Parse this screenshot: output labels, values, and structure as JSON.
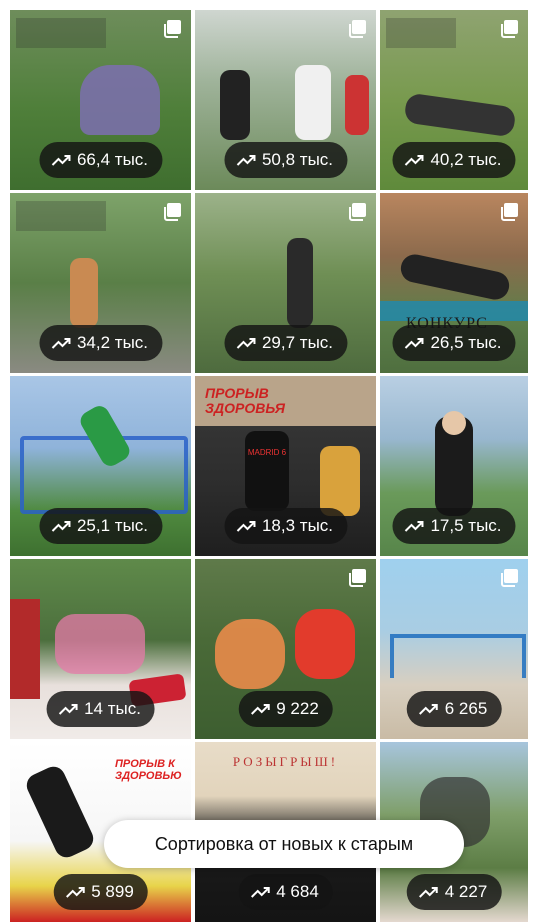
{
  "tiles": [
    {
      "views": "66,4 тыс.",
      "multi": true
    },
    {
      "views": "50,8 тыс.",
      "multi": true
    },
    {
      "views": "40,2 тыс.",
      "multi": true
    },
    {
      "views": "34,2 тыс.",
      "multi": true
    },
    {
      "views": "29,7 тыс.",
      "multi": true
    },
    {
      "views": "26,5 тыс.",
      "multi": true,
      "caption": "КОНКУРС"
    },
    {
      "views": "25,1 тыс.",
      "multi": false
    },
    {
      "views": "18,3 тыс.",
      "multi": false,
      "caption": "ПРОРЫВ ЗДОРОВЬЯ",
      "jersey": "MADRID 6"
    },
    {
      "views": "17,5 тыс.",
      "multi": false
    },
    {
      "views": "14 тыс.",
      "multi": false
    },
    {
      "views": "9 222",
      "multi": true
    },
    {
      "views": "6 265",
      "multi": true
    },
    {
      "views": "5 899",
      "multi": false,
      "caption": "ПРОРЫВ К ЗДОРОВЬЮ"
    },
    {
      "views": "4 684",
      "multi": false,
      "caption": "РОЗЫГРЫШ!"
    },
    {
      "views": "4 227",
      "multi": false
    }
  ],
  "toast": {
    "label": "Сортировка от новых к старым"
  },
  "colors": {
    "badge_bg": "#141414",
    "toast_bg": "#ffffff"
  },
  "icons": {
    "views": "trending-up-icon",
    "multi": "multiple-photos-icon"
  }
}
